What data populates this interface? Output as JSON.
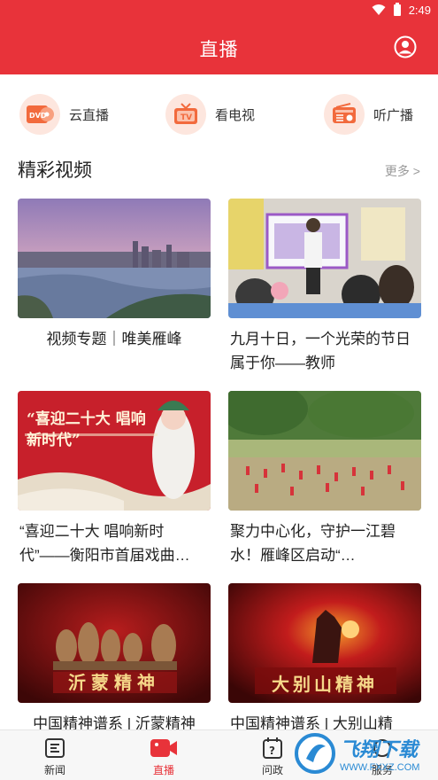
{
  "status_bar": {
    "time": "2:49"
  },
  "header": {
    "title": "直播"
  },
  "quick_links": [
    {
      "label": "云直播",
      "icon": "dvd-icon"
    },
    {
      "label": "看电视",
      "icon": "tv-icon"
    },
    {
      "label": "听广播",
      "icon": "radio-icon"
    }
  ],
  "section": {
    "title": "精彩视频",
    "more": "更多 >"
  },
  "videos": [
    {
      "title": "视频专题｜唯美雁峰"
    },
    {
      "title": "九月十日，一个光荣的节日 属于你——教师"
    },
    {
      "title": "“喜迎二十大 唱响新时代”——衡阳市首届戏曲…",
      "thumb_text": "“喜迎二十大 唱响新时代”"
    },
    {
      "title": "聚力中心化，守护一江碧水！雁峰区启动“…"
    },
    {
      "title": "中国精神谱系 | 沂蒙精神",
      "thumb_text": "沂蒙精神"
    },
    {
      "title": "中国精神谱系 | 大别山精",
      "thumb_text": "大别山精神"
    }
  ],
  "tabs": [
    {
      "label": "新闻"
    },
    {
      "label": "直播"
    },
    {
      "label": "问政"
    },
    {
      "label": "服务"
    }
  ],
  "watermark": {
    "text": "飞翔下载",
    "sub": "WWW.FXXZ.COM"
  }
}
